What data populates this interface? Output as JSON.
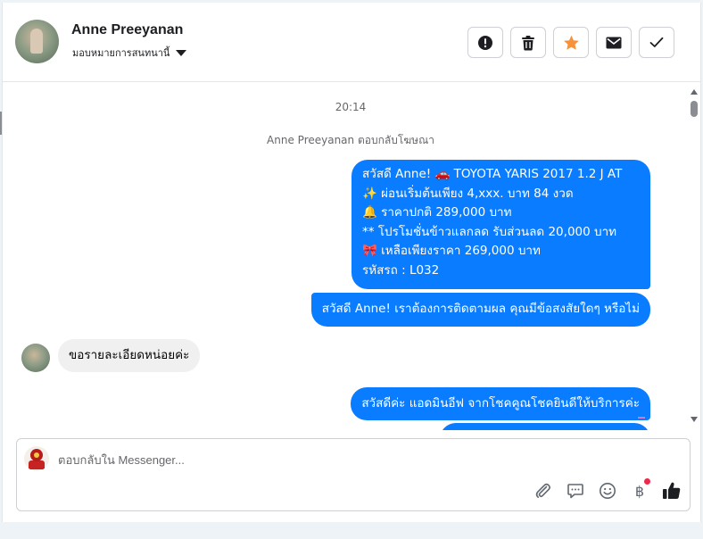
{
  "header": {
    "contact_name": "Anne Preeyanan",
    "assign_label": "มอบหมายการสนทนานี้",
    "actions": [
      {
        "name": "spam-button",
        "icon": "alert-icon"
      },
      {
        "name": "delete-button",
        "icon": "trash-icon"
      },
      {
        "name": "follow-up-button",
        "icon": "star-icon",
        "color": "#f7923b"
      },
      {
        "name": "mark-unread-button",
        "icon": "envelope-icon"
      },
      {
        "name": "mark-done-button",
        "icon": "checkmark-icon"
      }
    ]
  },
  "thread": {
    "timestamp": "20:14",
    "reply_note": "Anne Preeyanan ตอบกลับโฆษณา",
    "messages": [
      {
        "direction": "outgoing",
        "lines": [
          "สวัสดี Anne! 🚗  TOYOTA YARIS 2017 1.2 J AT",
          "✨  ผ่อนเริ่มต้นเพียง 4,xxx. บาท 84 งวด",
          "🔔 ราคาปกติ 289,000 บาท",
          "** โปรโมชั่นข้าวแลกลด รับส่วนลด 20,000 บาท",
          "🎀  เหลือเพียงราคา 269,000 บาท",
          " รหัสรถ : L032"
        ]
      },
      {
        "direction": "outgoing",
        "text": "สวัสดี Anne! เราต้องการติดตามผล คุณมีข้อสงสัยใดๆ หรือไม่"
      },
      {
        "direction": "incoming",
        "text": "ขอรายละเอียดหน่อยค่ะ"
      },
      {
        "direction": "outgoing",
        "text": "สวัสดีค่ะ แอดมินอีฟ จากโชคคูณโชคยินดีให้บริการค่ะ"
      }
    ],
    "outgoing_color": "#0a7cff"
  },
  "composer": {
    "placeholder": "ตอบกลับใน Messenger...",
    "tools": [
      "attachment-icon",
      "saved-reply-icon",
      "emoji-icon",
      "baht-payment-icon",
      "thumbs-up-icon"
    ],
    "baht_symbol": "฿"
  }
}
